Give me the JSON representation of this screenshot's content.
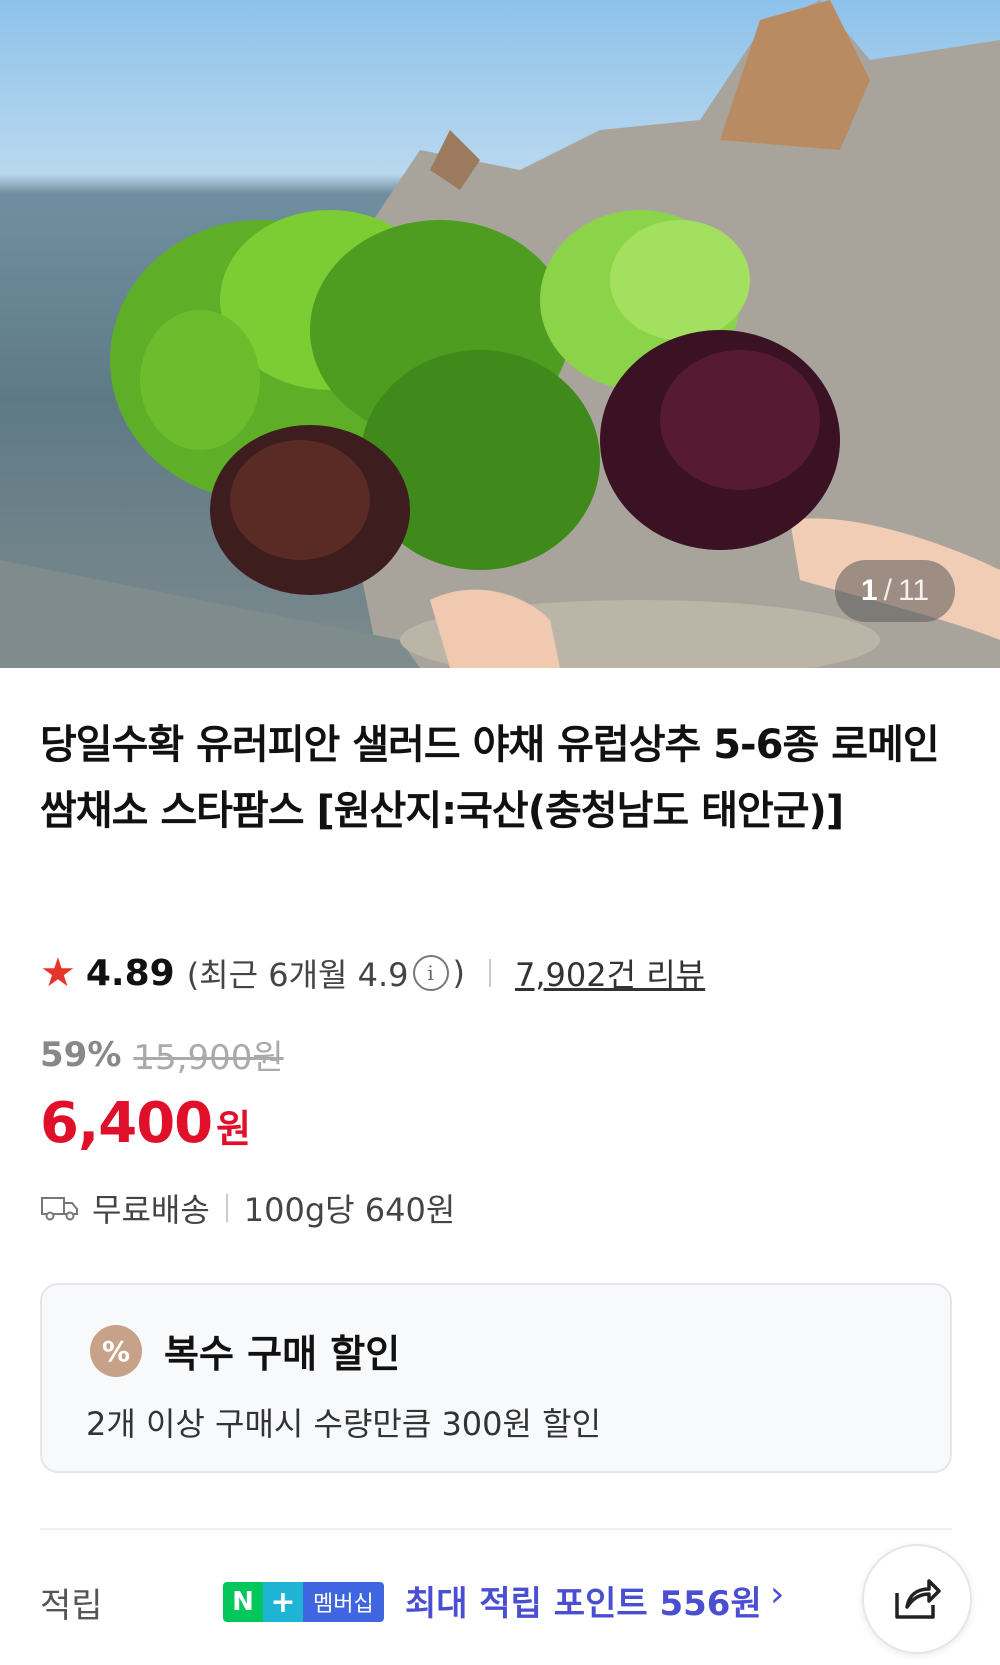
{
  "gallery": {
    "current": "1",
    "separator": "/",
    "total": "11"
  },
  "product": {
    "title": "당일수확 유러피안 샐러드 야채 유럽상추 5-6종 로메인 쌈채소 스타팜스 [원산지:국산(충청남도 태안군)]"
  },
  "rating": {
    "score": "4.89",
    "recent_label": "(최근 6개월 4.9",
    "recent_close": ")",
    "reviews": "7,902건 리뷰",
    "star_color": "#e5352a"
  },
  "price": {
    "discount": "59%",
    "original": "15,900원",
    "sale": "6,400",
    "currency": "원",
    "sale_color": "#e0102b"
  },
  "shipping": {
    "label": "무료배송",
    "unit_price": "100g당 640원"
  },
  "promo": {
    "badge": "%",
    "title": "복수 구매 할인",
    "description": "2개 이상 구매시 수량만큼 300원 할인"
  },
  "points": {
    "label": "적립",
    "badge_n": "N",
    "badge_plus": "+",
    "badge_membership": "멤버십",
    "text": "최대 적립 포인트 556원",
    "chevron": "›",
    "color": "#4a4fd1"
  }
}
